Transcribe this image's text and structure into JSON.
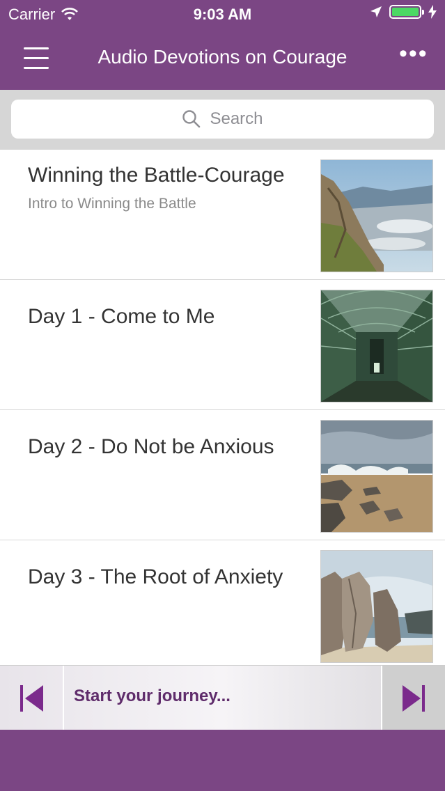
{
  "status_bar": {
    "carrier": "Carrier",
    "time": "9:03 AM",
    "battery_color": "#4cd964"
  },
  "nav": {
    "title": "Audio Devotions on Courage",
    "menu_icon": "hamburger-icon",
    "more_icon": "more-icon",
    "more_glyph": "•••"
  },
  "search": {
    "placeholder": "Search"
  },
  "list": {
    "items": [
      {
        "title": "Winning the Battle-Courage",
        "subtitle": "Intro to Winning the Battle",
        "thumbnail": "mountain-valley"
      },
      {
        "title": "Day 1 - Come to Me",
        "subtitle": "",
        "thumbnail": "green-tunnel"
      },
      {
        "title": "Day 2 - Do Not be Anxious",
        "subtitle": "",
        "thumbnail": "rocky-beach-waves"
      },
      {
        "title": "Day 3 - The Root of Anxiety",
        "subtitle": "",
        "thumbnail": "boulders-shore"
      }
    ]
  },
  "player": {
    "now_playing": "Start your journey...",
    "accent_color": "#7b2a8c"
  },
  "colors": {
    "brand": "#7b4684",
    "search_bg": "#d6d6d6"
  }
}
